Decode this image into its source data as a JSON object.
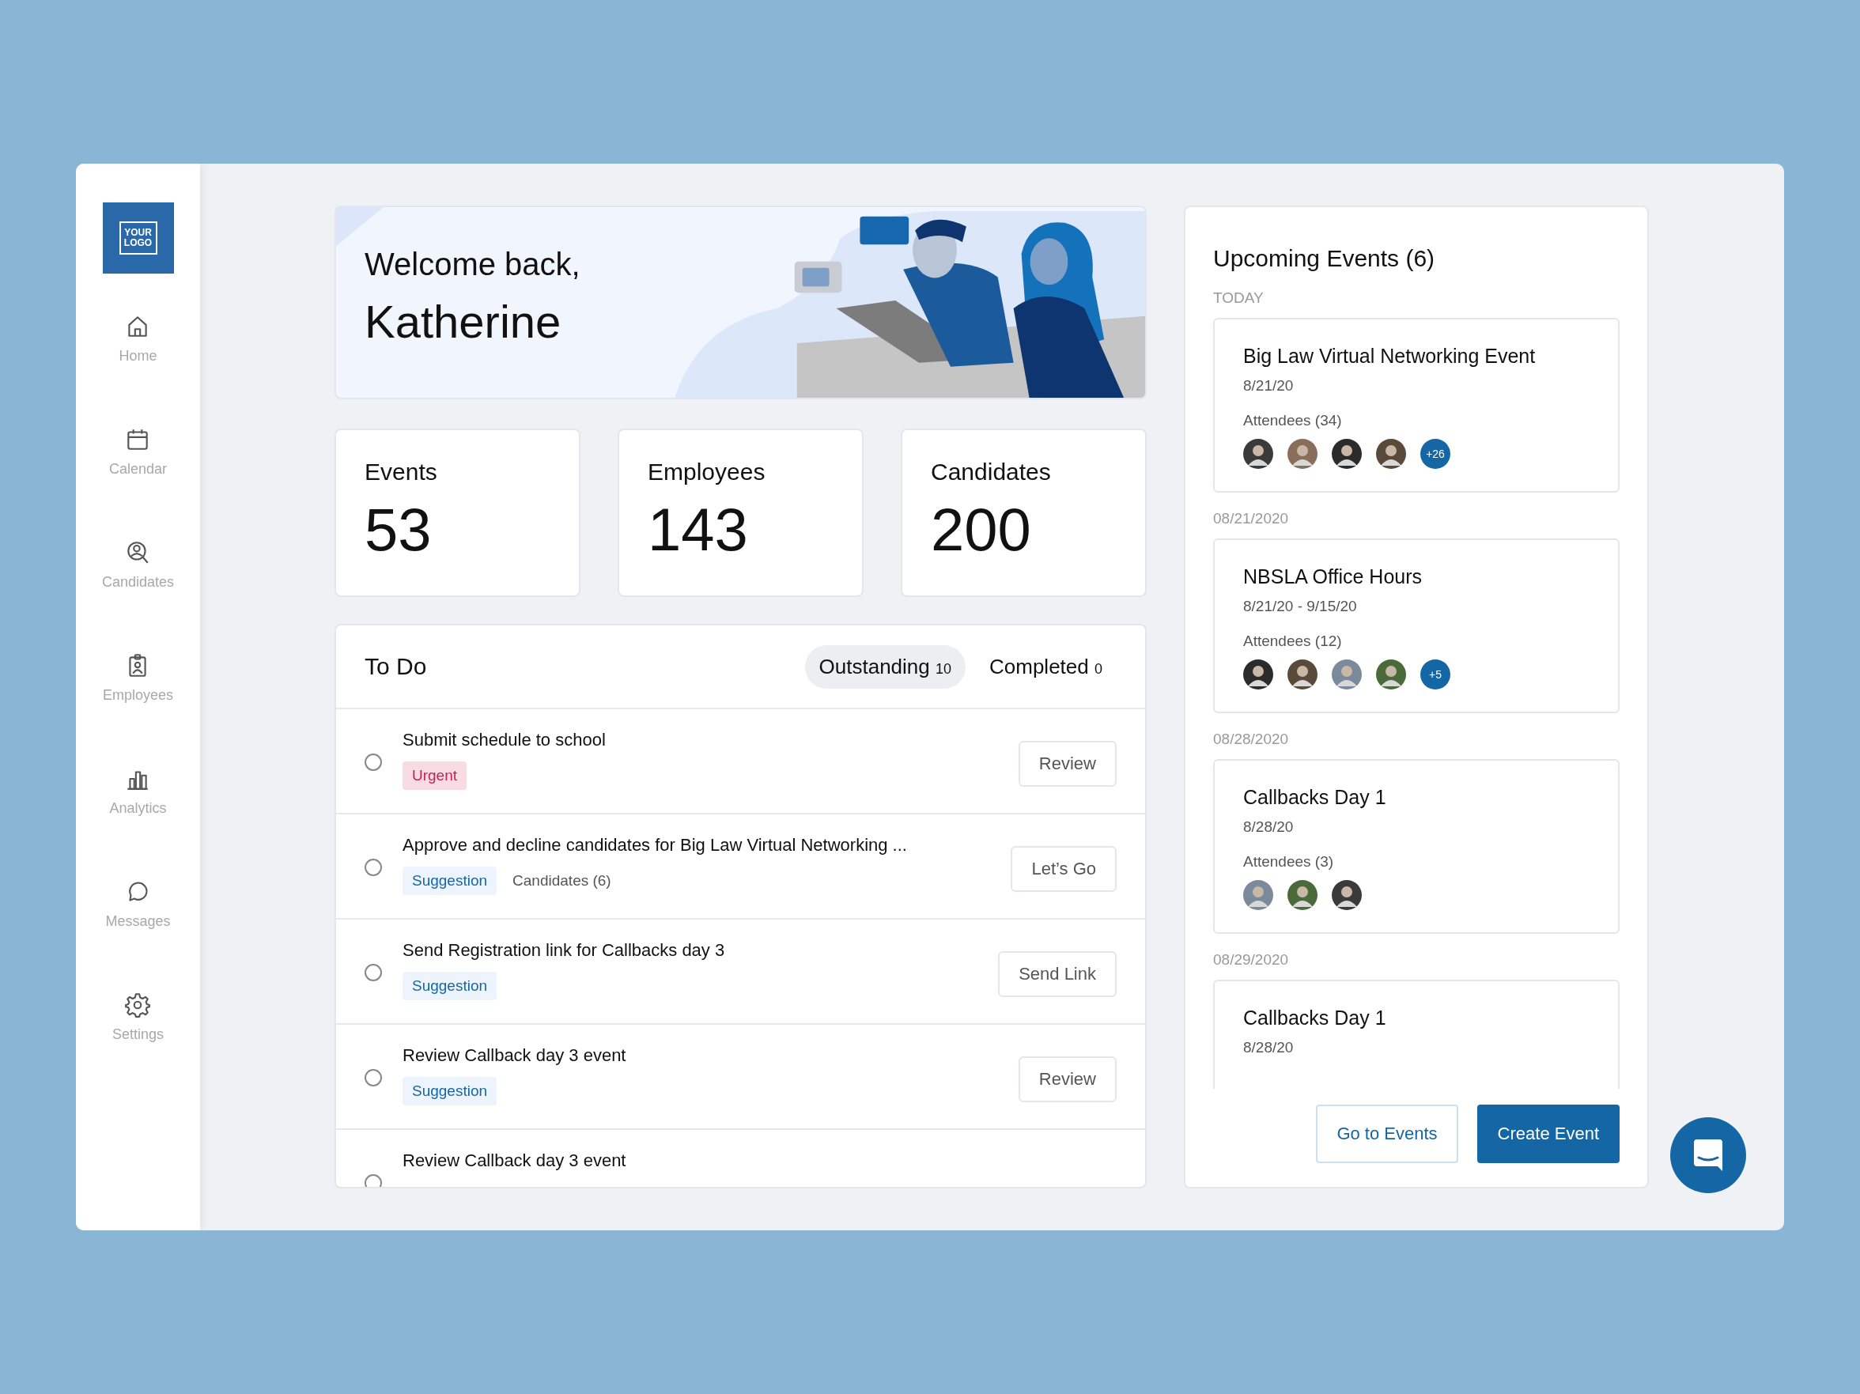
{
  "sidebar": {
    "logo": {
      "line_1": "YOUR",
      "line_2": "LOGO"
    },
    "items": [
      {
        "label": "Home",
        "kind": "home",
        "selected": false
      },
      {
        "label": "Calendar",
        "kind": "calendar",
        "selected": false
      },
      {
        "label": "Candidates",
        "kind": "search",
        "selected": false
      },
      {
        "label": "Employees",
        "kind": "badge",
        "selected": false
      },
      {
        "label": "Analytics",
        "kind": "chart",
        "selected": false
      },
      {
        "label": "Messages",
        "kind": "chat",
        "selected": false
      },
      {
        "label": "Settings",
        "kind": "settings",
        "selected": false
      }
    ]
  },
  "welcome": {
    "greeting": "Welcome back,",
    "name": "Katherine"
  },
  "stats": [
    {
      "label": "Events",
      "value": "53"
    },
    {
      "label": "Employees",
      "value": "143"
    },
    {
      "label": "Candidates",
      "value": "200"
    }
  ],
  "todo": {
    "title": "To Do",
    "tabs": [
      {
        "label": "Outstanding",
        "count": "10",
        "selected": true
      },
      {
        "label": "Completed",
        "count": "0",
        "selected": false
      }
    ],
    "items": [
      {
        "title": "Submit schedule to school",
        "checked": false,
        "tag": {
          "label": "Urgent",
          "kind": "urgent"
        },
        "button": "Review"
      },
      {
        "title": "Approve and decline candidates for Big Law Virtual Networking ...",
        "checked": false,
        "tag": {
          "label": "Suggestion",
          "kind": "suggestion"
        },
        "note": "Candidates (6)",
        "button": "Let’s Go"
      },
      {
        "title": "Send Registration link for Callbacks day 3",
        "checked": false,
        "tag": {
          "label": "Suggestion",
          "kind": "suggestion"
        },
        "button": "Send Link"
      },
      {
        "title": "Review Callback day 3 event",
        "checked": false,
        "tag": {
          "label": "Suggestion",
          "kind": "suggestion"
        },
        "button": "Review"
      },
      {
        "title": "Review Callback day 3 event",
        "checked": false
      }
    ]
  },
  "events": {
    "title": "Upcoming Events (6)",
    "groups": [
      {
        "label": "TODAY",
        "event": {
          "title": "Big Law Virtual Networking Event",
          "date": "8/21/20",
          "attendees": "Attendees (34)",
          "more": "+26"
        }
      },
      {
        "label": "08/21/2020",
        "event": {
          "title": "NBSLA Office Hours",
          "date": "8/21/20 - 9/15/20",
          "attendees": "Attendees (12)",
          "more": "+5"
        }
      },
      {
        "label": "08/28/2020",
        "event": {
          "title": "Callbacks Day 1",
          "date": "8/28/20",
          "attendees": "Attendees (3)"
        }
      },
      {
        "label": "08/29/2020",
        "event": {
          "title": "Callbacks Day 1",
          "date": "8/28/20"
        }
      }
    ],
    "buttons": [
      {
        "label": "Go to Events",
        "kind": "secondary"
      },
      {
        "label": "Create Event",
        "kind": "primary"
      }
    ]
  }
}
